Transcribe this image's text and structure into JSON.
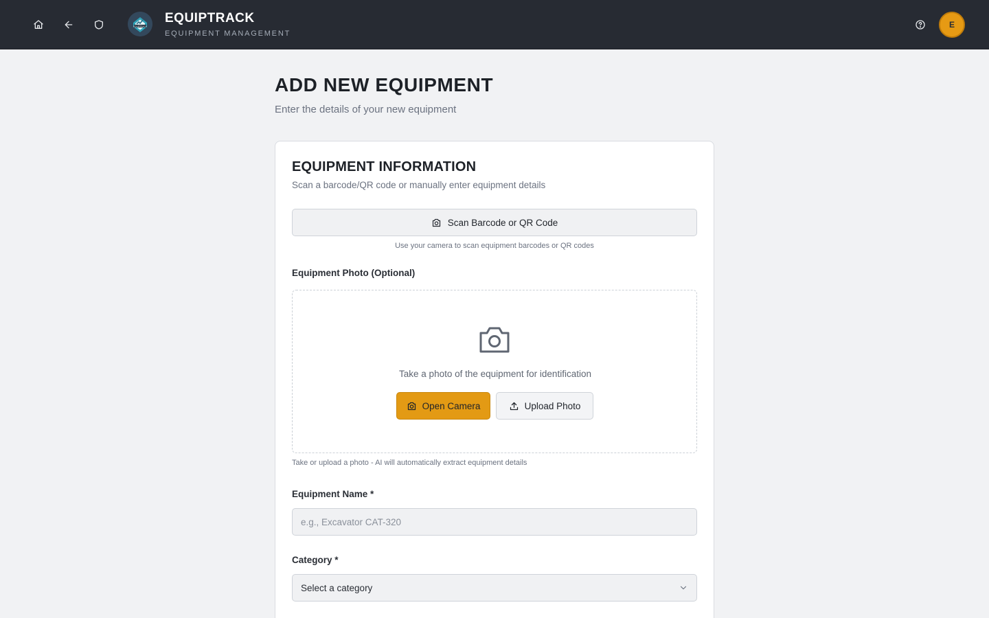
{
  "header": {
    "brand_title": "EQUIPTRACK",
    "brand_subtitle": "EQUIPMENT MANAGEMENT",
    "logo_text": "EQUIPTRACK",
    "avatar_initial": "E",
    "icons": [
      "home-icon",
      "back-arrow-icon",
      "shield-icon",
      "help-icon"
    ]
  },
  "page": {
    "title": "ADD NEW EQUIPMENT",
    "subtitle": "Enter the details of your new equipment"
  },
  "card": {
    "title": "EQUIPMENT INFORMATION",
    "subtitle": "Scan a barcode/QR code or manually enter equipment details",
    "scan_button": "Scan Barcode or QR Code",
    "scan_hint": "Use your camera to scan equipment barcodes or QR codes",
    "photo_label": "Equipment Photo (Optional)",
    "photo_prompt": "Take a photo of the equipment for identification",
    "open_camera": "Open Camera",
    "upload_photo": "Upload Photo",
    "photo_hint": "Take or upload a photo - AI will automatically extract equipment details",
    "name_label": "Equipment Name *",
    "name_placeholder": "e.g., Excavator CAT-320",
    "name_value": "",
    "category_label": "Category *",
    "category_value": "Select a category"
  },
  "colors": {
    "header_bg": "#272b33",
    "accent": "#e39a14",
    "page_bg": "#f1f2f4"
  }
}
